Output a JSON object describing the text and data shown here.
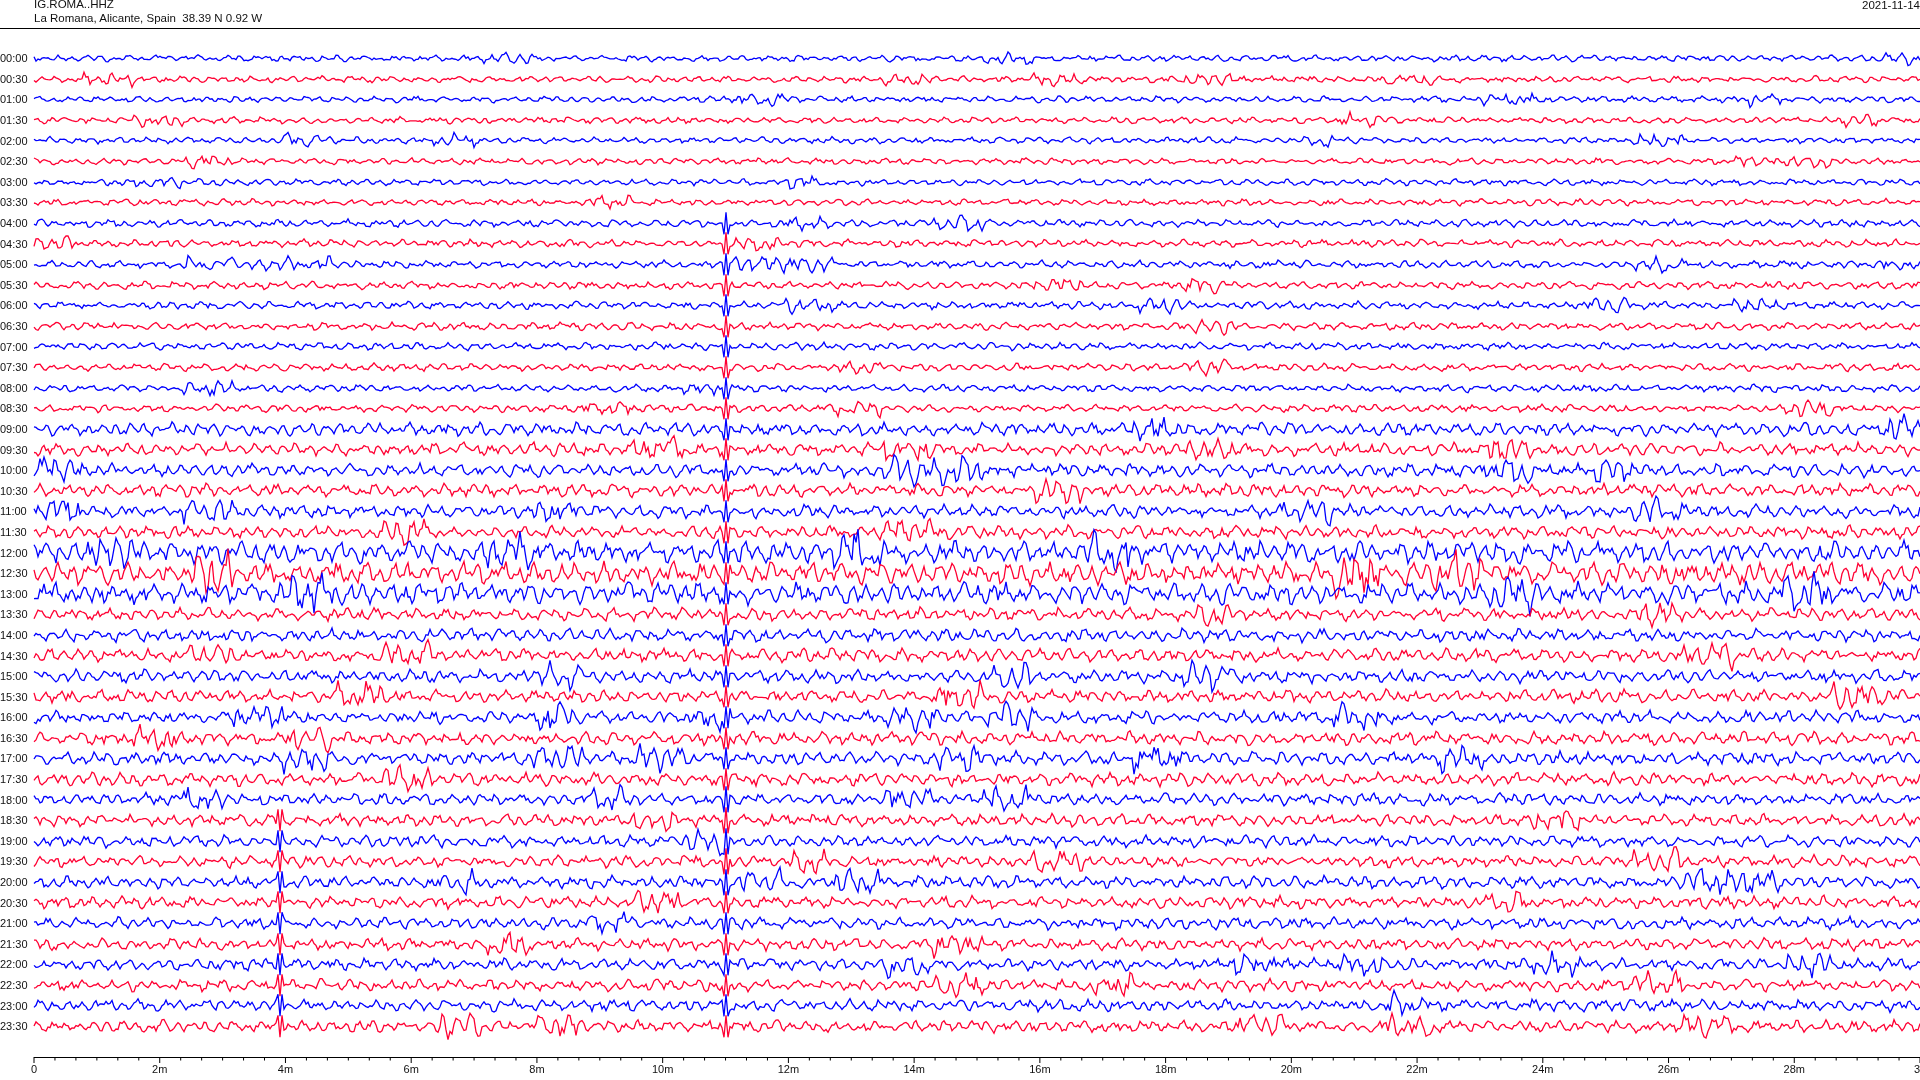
{
  "header": {
    "station": "IG.ROMA..HHZ",
    "location": "La Romana, Alicante, Spain  38.39 N 0.92 W",
    "date": "2021-11-14"
  },
  "rows": [
    {
      "time": "00:00",
      "color": "#0000ff"
    },
    {
      "time": "00:30",
      "color": "#ff0033"
    },
    {
      "time": "01:00",
      "color": "#0000ff"
    },
    {
      "time": "01:30",
      "color": "#ff0033"
    },
    {
      "time": "02:00",
      "color": "#0000ff"
    },
    {
      "time": "02:30",
      "color": "#ff0033"
    },
    {
      "time": "03:00",
      "color": "#0000ff"
    },
    {
      "time": "03:30",
      "color": "#ff0033"
    },
    {
      "time": "04:00",
      "color": "#0000ff"
    },
    {
      "time": "04:30",
      "color": "#ff0033"
    },
    {
      "time": "05:00",
      "color": "#0000ff"
    },
    {
      "time": "05:30",
      "color": "#ff0033"
    },
    {
      "time": "06:00",
      "color": "#0000ff"
    },
    {
      "time": "06:30",
      "color": "#ff0033"
    },
    {
      "time": "07:00",
      "color": "#0000ff"
    },
    {
      "time": "07:30",
      "color": "#ff0033"
    },
    {
      "time": "08:00",
      "color": "#0000ff"
    },
    {
      "time": "08:30",
      "color": "#ff0033"
    },
    {
      "time": "09:00",
      "color": "#0000ff"
    },
    {
      "time": "09:30",
      "color": "#ff0033"
    },
    {
      "time": "10:00",
      "color": "#0000ff"
    },
    {
      "time": "10:30",
      "color": "#ff0033"
    },
    {
      "time": "11:00",
      "color": "#0000ff"
    },
    {
      "time": "11:30",
      "color": "#ff0033"
    },
    {
      "time": "12:00",
      "color": "#0000ff"
    },
    {
      "time": "12:30",
      "color": "#ff0033"
    },
    {
      "time": "13:00",
      "color": "#0000ff"
    },
    {
      "time": "13:30",
      "color": "#ff0033"
    },
    {
      "time": "14:00",
      "color": "#0000ff"
    },
    {
      "time": "14:30",
      "color": "#ff0033"
    },
    {
      "time": "15:00",
      "color": "#0000ff"
    },
    {
      "time": "15:30",
      "color": "#ff0033"
    },
    {
      "time": "16:00",
      "color": "#0000ff"
    },
    {
      "time": "16:30",
      "color": "#ff0033"
    },
    {
      "time": "17:00",
      "color": "#0000ff"
    },
    {
      "time": "17:30",
      "color": "#ff0033"
    },
    {
      "time": "18:00",
      "color": "#0000ff"
    },
    {
      "time": "18:30",
      "color": "#ff0033"
    },
    {
      "time": "19:00",
      "color": "#0000ff"
    },
    {
      "time": "19:30",
      "color": "#ff0033"
    },
    {
      "time": "20:00",
      "color": "#0000ff"
    },
    {
      "time": "20:30",
      "color": "#ff0033"
    },
    {
      "time": "21:00",
      "color": "#0000ff"
    },
    {
      "time": "21:30",
      "color": "#ff0033"
    },
    {
      "time": "22:00",
      "color": "#0000ff"
    },
    {
      "time": "22:30",
      "color": "#ff0033"
    },
    {
      "time": "23:00",
      "color": "#0000ff"
    },
    {
      "time": "23:30",
      "color": "#ff0033"
    }
  ],
  "x_axis": {
    "labels": [
      "0",
      "2m",
      "4m",
      "6m",
      "8m",
      "10m",
      "12m",
      "14m",
      "16m",
      "18m",
      "20m",
      "22m",
      "24m",
      "26m",
      "28m",
      "3"
    ]
  }
}
